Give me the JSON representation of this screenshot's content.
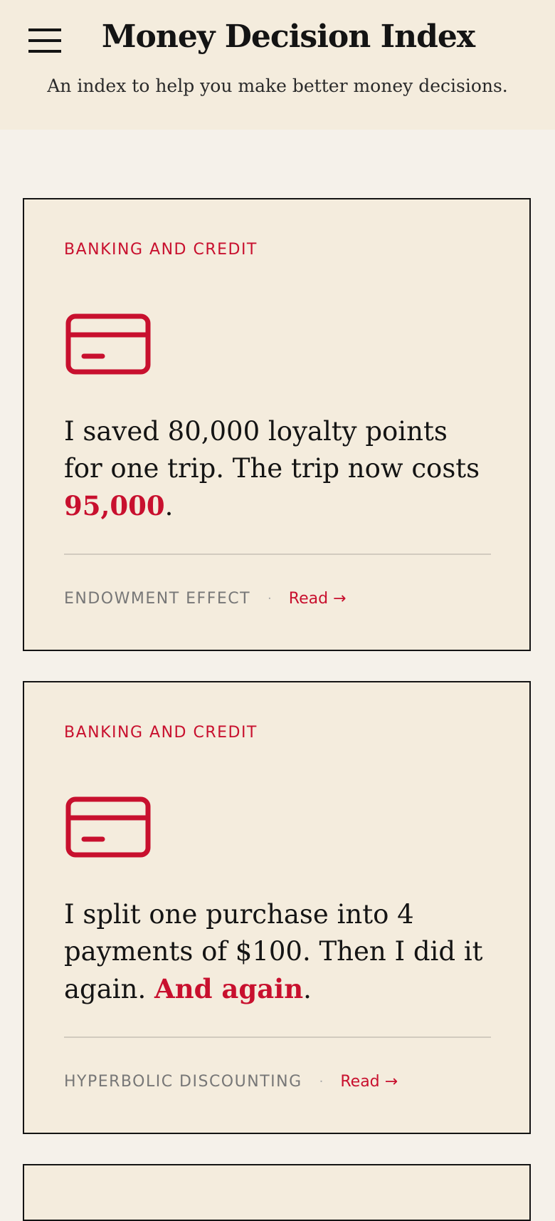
{
  "header": {
    "title": "Money Decision Index",
    "subtitle": "An index to help you make better money decisions."
  },
  "cards": [
    {
      "category": "BANKING AND CREDIT",
      "icon": "credit-card-icon",
      "text_pre": "I saved 80,000 loyalty points for one trip. The trip now costs ",
      "text_highlight": "95,000",
      "text_post": ".",
      "tag": "ENDOWMENT EFFECT",
      "separator": "·",
      "read_label": "Read →"
    },
    {
      "category": "BANKING AND CREDIT",
      "icon": "credit-card-icon",
      "text_pre": "I split one purchase into 4 payments of $100. Then I did it again. ",
      "text_highlight": "And again",
      "text_post": ".",
      "tag": "HYPERBOLIC DISCOUNTING",
      "separator": "·",
      "read_label": "Read →"
    }
  ],
  "colors": {
    "accent": "#c8102e",
    "header_bg": "#f4ecdd",
    "page_bg": "#f5f1ea",
    "text": "#141414"
  }
}
